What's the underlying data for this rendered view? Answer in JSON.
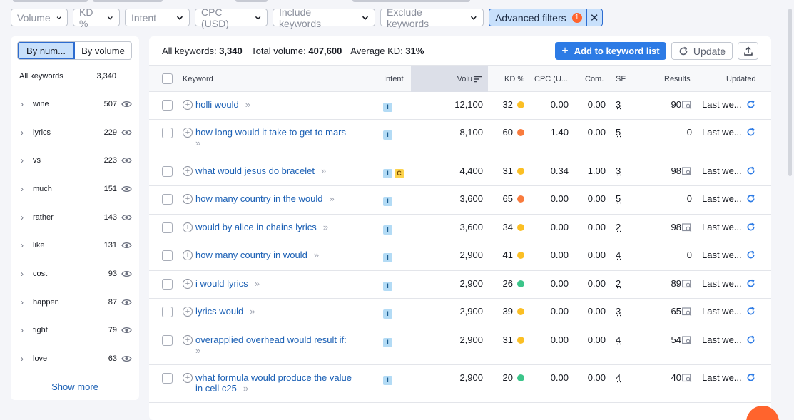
{
  "filters": {
    "volume": "Volume",
    "kd": "KD %",
    "intent": "Intent",
    "cpc": "CPC (USD)",
    "include": "Include keywords",
    "exclude": "Exclude keywords",
    "advanced": "Advanced filters",
    "advanced_count": "1",
    "clear_glyph": "✕"
  },
  "sidebar": {
    "by_number": "By num...",
    "by_volume": "By volume",
    "all_keywords_label": "All keywords",
    "all_keywords_count": "3,340",
    "groups": [
      {
        "name": "wine",
        "count": "507"
      },
      {
        "name": "lyrics",
        "count": "229"
      },
      {
        "name": "vs",
        "count": "223"
      },
      {
        "name": "much",
        "count": "151"
      },
      {
        "name": "rather",
        "count": "143"
      },
      {
        "name": "like",
        "count": "131"
      },
      {
        "name": "cost",
        "count": "93"
      },
      {
        "name": "happen",
        "count": "87"
      },
      {
        "name": "fight",
        "count": "79"
      },
      {
        "name": "love",
        "count": "63"
      }
    ],
    "show_more": "Show more"
  },
  "summary": {
    "all_label": "All keywords:",
    "all_value": "3,340",
    "volume_label": "Total volume:",
    "volume_value": "407,600",
    "kd_label": "Average KD:",
    "kd_value": "31%"
  },
  "toolbar": {
    "add_label": "Add to keyword list",
    "update_label": "Update"
  },
  "columns": {
    "keyword": "Keyword",
    "intent": "Intent",
    "volume": "Volu",
    "kd": "KD %",
    "cpc": "CPC (U...",
    "com": "Com.",
    "sf": "SF",
    "results": "Results",
    "updated": "Updated"
  },
  "colors": {
    "kd_yellow": "#fbbf24",
    "kd_orange": "#f97b3d",
    "kd_green": "#3cc58a",
    "accent": "#2d7be5"
  },
  "rows": [
    {
      "keyword": "holli would",
      "kw2": "",
      "intent": [
        "I"
      ],
      "volume": "12,100",
      "kd": "32",
      "kd_color": "#fbbf24",
      "cpc": "0.00",
      "com": "0.00",
      "sf": "3",
      "results": "90",
      "serp": true,
      "updated": "Last we..."
    },
    {
      "keyword": "how long would it take to get to mars",
      "kw2": "",
      "intent": [
        "I"
      ],
      "volume": "8,100",
      "kd": "60",
      "kd_color": "#f97b3d",
      "cpc": "1.40",
      "com": "0.00",
      "sf": "5",
      "results": "0",
      "serp": false,
      "updated": "Last we...",
      "tall": true
    },
    {
      "keyword": "what would jesus do bracelet",
      "kw2": "",
      "intent": [
        "I",
        "C"
      ],
      "volume": "4,400",
      "kd": "31",
      "kd_color": "#fbbf24",
      "cpc": "0.34",
      "com": "1.00",
      "sf": "3",
      "results": "98",
      "serp": true,
      "updated": "Last we..."
    },
    {
      "keyword": "how many country in the would",
      "kw2": "",
      "intent": [
        "I"
      ],
      "volume": "3,600",
      "kd": "65",
      "kd_color": "#f97b3d",
      "cpc": "0.00",
      "com": "0.00",
      "sf": "5",
      "results": "0",
      "serp": false,
      "updated": "Last we..."
    },
    {
      "keyword": "would by alice in chains lyrics",
      "kw2": "",
      "intent": [
        "I"
      ],
      "volume": "3,600",
      "kd": "34",
      "kd_color": "#fbbf24",
      "cpc": "0.00",
      "com": "0.00",
      "sf": "2",
      "results": "98",
      "serp": true,
      "updated": "Last we..."
    },
    {
      "keyword": "how many country in would",
      "kw2": "",
      "intent": [
        "I"
      ],
      "volume": "2,900",
      "kd": "41",
      "kd_color": "#fbbf24",
      "cpc": "0.00",
      "com": "0.00",
      "sf": "4",
      "results": "0",
      "serp": false,
      "updated": "Last we..."
    },
    {
      "keyword": "i would lyrics",
      "kw2": "",
      "intent": [
        "I"
      ],
      "volume": "2,900",
      "kd": "26",
      "kd_color": "#3cc58a",
      "cpc": "0.00",
      "com": "0.00",
      "sf": "2",
      "results": "89",
      "serp": true,
      "updated": "Last we..."
    },
    {
      "keyword": "lyrics would",
      "kw2": "",
      "intent": [
        "I"
      ],
      "volume": "2,900",
      "kd": "39",
      "kd_color": "#fbbf24",
      "cpc": "0.00",
      "com": "0.00",
      "sf": "3",
      "results": "65",
      "serp": true,
      "updated": "Last we..."
    },
    {
      "keyword": "overapplied overhead would result if:",
      "kw2": "",
      "intent": [
        "I"
      ],
      "volume": "2,900",
      "kd": "31",
      "kd_color": "#fbbf24",
      "cpc": "0.00",
      "com": "0.00",
      "sf": "4",
      "results": "54",
      "serp": true,
      "updated": "Last we...",
      "tall": true
    },
    {
      "keyword": "what formula would produce the value",
      "kw2": "in cell c25",
      "intent": [
        "I"
      ],
      "volume": "2,900",
      "kd": "20",
      "kd_color": "#3cc58a",
      "cpc": "0.00",
      "com": "0.00",
      "sf": "4",
      "results": "40",
      "serp": true,
      "updated": "Last we...",
      "tall": true
    }
  ]
}
